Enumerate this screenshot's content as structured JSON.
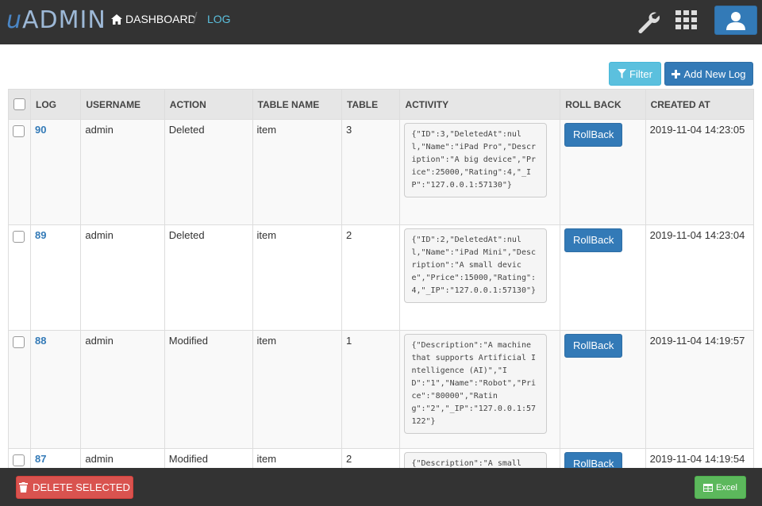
{
  "header": {
    "logo": {
      "u": "u",
      "rest": "ADMIN"
    },
    "breadcrumb": {
      "home": "DASHBOARD",
      "sep": "/",
      "current": "LOG"
    }
  },
  "toolbar": {
    "filter_label": "Filter",
    "add_label": "Add New Log"
  },
  "table": {
    "columns": [
      "LOG",
      "USERNAME",
      "ACTION",
      "TABLE NAME",
      "TABLE",
      "ACTIVITY",
      "ROLL BACK",
      "CREATED AT"
    ],
    "rows": [
      {
        "log": "90",
        "username": "admin",
        "action": "Deleted",
        "table_name": "item",
        "table": "3",
        "activity": "{\"ID\":3,\"DeletedAt\":null,\"Name\":\"iPad Pro\",\"Description\":\"A big device\",\"Price\":25000,\"Rating\":4,\"_IP\":\"127.0.0.1:57130\"}",
        "rollback": "RollBack",
        "created_at": "2019-11-04 14:23:05"
      },
      {
        "log": "89",
        "username": "admin",
        "action": "Deleted",
        "table_name": "item",
        "table": "2",
        "activity": "{\"ID\":2,\"DeletedAt\":null,\"Name\":\"iPad Mini\",\"Description\":\"A small device\",\"Price\":15000,\"Rating\":4,\"_IP\":\"127.0.0.1:57130\"}",
        "rollback": "RollBack",
        "created_at": "2019-11-04 14:23:04"
      },
      {
        "log": "88",
        "username": "admin",
        "action": "Modified",
        "table_name": "item",
        "table": "1",
        "activity": "{\"Description\":\"A machine that supports Artificial Intelligence (AI)\",\"ID\":\"1\",\"Name\":\"Robot\",\"Price\":\"80000\",\"Rating\":\"2\",\"_IP\":\"127.0.0.1:57122\"}",
        "rollback": "RollBack",
        "created_at": "2019-11-04 14:19:57"
      },
      {
        "log": "87",
        "username": "admin",
        "action": "Modified",
        "table_name": "item",
        "table": "2",
        "activity": "{\"Description\":\"A small",
        "rollback": "RollBack",
        "created_at": "2019-11-04 14:19:54"
      }
    ]
  },
  "footer": {
    "delete_label": "DELETE SELECTED",
    "excel_label": "Excel"
  },
  "colors": {
    "topbar": "#333333",
    "primary": "#337ab7",
    "info": "#5bc0de",
    "danger": "#d9534f",
    "success": "#5cb85c"
  }
}
